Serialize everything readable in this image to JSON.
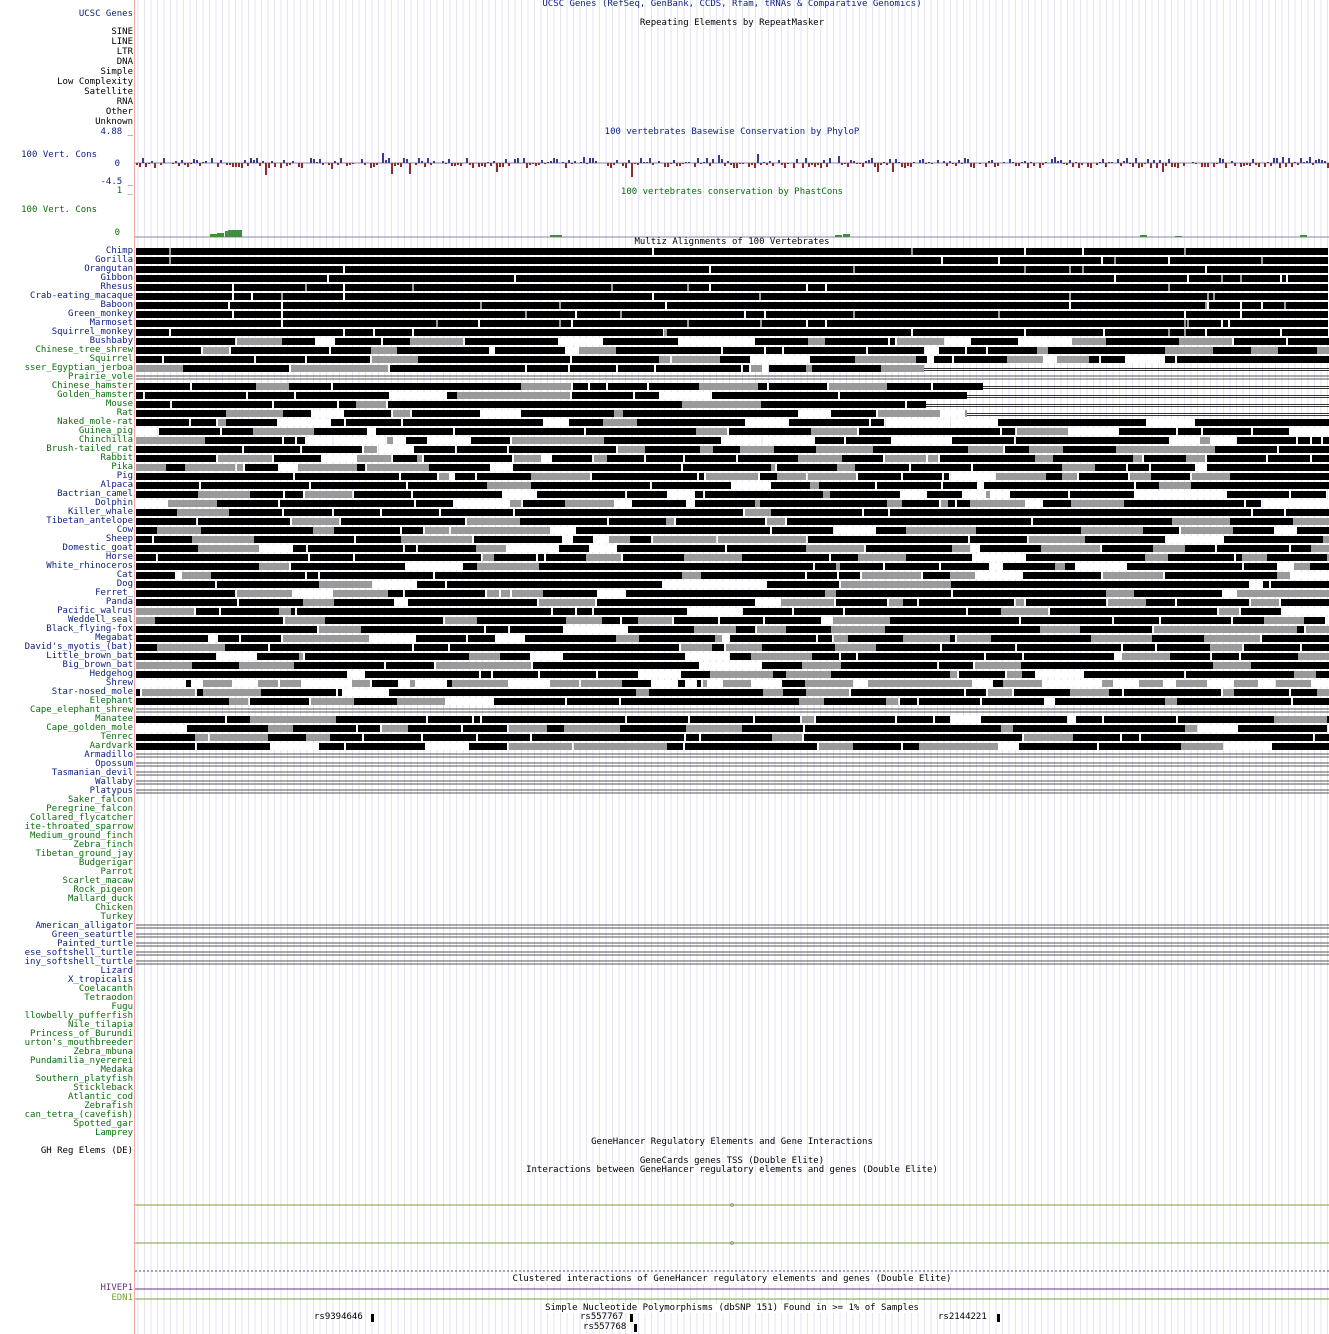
{
  "colors": {
    "navy": "#0b1e80",
    "green": "#0b6e0b",
    "black": "#000000",
    "purple": "#6b2f80",
    "olive": "#7ca13a",
    "phylop_pos": "#3b3a8f",
    "phylop_neg": "#8c2c2c",
    "phastcons": "#3f8f3f",
    "gray": "#9a9a9a",
    "lightgray": "#d6d6d6"
  },
  "ucsc_genes": {
    "label": "UCSC Genes",
    "title": "UCSC Genes (RefSeq, GenBank, CCDS, Rfam, tRNAs & Comparative Genomics)"
  },
  "repeatmasker": {
    "title": "Repeating Elements by RepeatMasker",
    "classes": [
      "SINE",
      "LINE",
      "LTR",
      "DNA",
      "Simple",
      "Low Complexity",
      "Satellite",
      "RNA",
      "Other",
      "Unknown"
    ]
  },
  "phylop": {
    "label": "100 Vert. Cons",
    "title": "100 vertebrates Basewise Conservation by PhyloP",
    "max_label": "4.88 _",
    "zero_label": "0",
    "min_label": "-4.5 _",
    "ymax": 4.88,
    "ymin": -4.5
  },
  "phastcons": {
    "label": "100 Vert. Cons",
    "title": "100 vertebrates conservation by PhastCons",
    "max_label": "1 _",
    "zero_label": "0"
  },
  "multiz": {
    "title": "Multiz Alignments of 100 Vertebrates",
    "species": [
      {
        "name": "Chimp",
        "group": "primate",
        "pattern": "dense"
      },
      {
        "name": "Gorilla",
        "group": "primate",
        "pattern": "dense"
      },
      {
        "name": "Orangutan",
        "group": "primate",
        "pattern": "dense"
      },
      {
        "name": "Gibbon",
        "group": "primate",
        "pattern": "dense"
      },
      {
        "name": "Rhesus",
        "group": "primate",
        "pattern": "dense"
      },
      {
        "name": "Crab-eating_macaque",
        "group": "primate",
        "pattern": "dense"
      },
      {
        "name": "Baboon",
        "group": "primate",
        "pattern": "dense"
      },
      {
        "name": "Green_monkey",
        "group": "primate",
        "pattern": "dense"
      },
      {
        "name": "Marmoset",
        "group": "primate",
        "pattern": "dense"
      },
      {
        "name": "Squirrel_monkey",
        "group": "primate",
        "pattern": "dense"
      },
      {
        "name": "Bushbaby",
        "group": "primate",
        "pattern": "mixed"
      },
      {
        "name": "Chinese_tree_shrew",
        "group": "euarchontoglires",
        "pattern": "mixed"
      },
      {
        "name": "Squirrel",
        "group": "euarchontoglires",
        "pattern": "mixed"
      },
      {
        "name": "sser_Egyptian_jerboa",
        "group": "euarchontoglires",
        "pattern": "partial"
      },
      {
        "name": "Prairie_vole",
        "group": "euarchontoglires",
        "pattern": "line"
      },
      {
        "name": "Chinese_hamster",
        "group": "euarchontoglires",
        "pattern": "partial"
      },
      {
        "name": "Golden_hamster",
        "group": "euarchontoglires",
        "pattern": "partial"
      },
      {
        "name": "Mouse",
        "group": "euarchontoglires",
        "pattern": "partial"
      },
      {
        "name": "Rat",
        "group": "euarchontoglires",
        "pattern": "partial"
      },
      {
        "name": "Naked_mole-rat",
        "group": "euarchontoglires",
        "pattern": "mixed"
      },
      {
        "name": "Guinea_pig",
        "group": "euarchontoglires",
        "pattern": "mixed"
      },
      {
        "name": "Chinchilla",
        "group": "euarchontoglires",
        "pattern": "mixed"
      },
      {
        "name": "Brush-tailed_rat",
        "group": "euarchontoglires",
        "pattern": "mixed"
      },
      {
        "name": "Rabbit",
        "group": "euarchontoglires",
        "pattern": "mixed"
      },
      {
        "name": "Pika",
        "group": "euarchontoglires",
        "pattern": "mixed"
      },
      {
        "name": "Pig",
        "group": "laurasiatheria",
        "pattern": "mixed"
      },
      {
        "name": "Alpaca",
        "group": "laurasiatheria",
        "pattern": "mixed"
      },
      {
        "name": "Bactrian_camel",
        "group": "laurasiatheria",
        "pattern": "mixed"
      },
      {
        "name": "Dolphin",
        "group": "laurasiatheria",
        "pattern": "mixed"
      },
      {
        "name": "Killer_whale",
        "group": "laurasiatheria",
        "pattern": "mixed"
      },
      {
        "name": "Tibetan_antelope",
        "group": "laurasiatheria",
        "pattern": "mixed"
      },
      {
        "name": "Cow",
        "group": "laurasiatheria",
        "pattern": "mixed"
      },
      {
        "name": "Sheep",
        "group": "laurasiatheria",
        "pattern": "mixed"
      },
      {
        "name": "Domestic_goat",
        "group": "laurasiatheria",
        "pattern": "mixed"
      },
      {
        "name": "Horse",
        "group": "laurasiatheria",
        "pattern": "mixed"
      },
      {
        "name": "White_rhinoceros",
        "group": "laurasiatheria",
        "pattern": "mixed"
      },
      {
        "name": "Cat",
        "group": "laurasiatheria",
        "pattern": "mixed"
      },
      {
        "name": "Dog",
        "group": "laurasiatheria",
        "pattern": "mixed"
      },
      {
        "name": "Ferret_",
        "group": "laurasiatheria",
        "pattern": "mixed"
      },
      {
        "name": "Panda",
        "group": "laurasiatheria",
        "pattern": "mixed"
      },
      {
        "name": "Pacific_walrus",
        "group": "laurasiatheria",
        "pattern": "mixed"
      },
      {
        "name": "Weddell_seal",
        "group": "laurasiatheria",
        "pattern": "mixed"
      },
      {
        "name": "Black_flying-fox",
        "group": "laurasiatheria",
        "pattern": "mixed"
      },
      {
        "name": "Megabat",
        "group": "laurasiatheria",
        "pattern": "mixed"
      },
      {
        "name": "David's_myotis_(bat)",
        "group": "laurasiatheria",
        "pattern": "mixed"
      },
      {
        "name": "Little_brown_bat",
        "group": "laurasiatheria",
        "pattern": "mixed"
      },
      {
        "name": "Big_brown_bat",
        "group": "laurasiatheria",
        "pattern": "mixed"
      },
      {
        "name": "Hedgehog",
        "group": "laurasiatheria",
        "pattern": "mixed"
      },
      {
        "name": "Shrew",
        "group": "laurasiatheria",
        "pattern": "sparse"
      },
      {
        "name": "Star-nosed_mole",
        "group": "laurasiatheria",
        "pattern": "mixed"
      },
      {
        "name": "Elephant",
        "group": "afrotheria",
        "pattern": "mixed"
      },
      {
        "name": "Cape_elephant_shrew",
        "group": "afrotheria",
        "pattern": "line"
      },
      {
        "name": "Manatee",
        "group": "afrotheria",
        "pattern": "mixed"
      },
      {
        "name": "Cape_golden_mole",
        "group": "afrotheria",
        "pattern": "mixed"
      },
      {
        "name": "Tenrec",
        "group": "afrotheria",
        "pattern": "mixed"
      },
      {
        "name": "Aardvark",
        "group": "afrotheria",
        "pattern": "mixed"
      },
      {
        "name": "Armadillo",
        "group": "xenarthra",
        "pattern": "line"
      },
      {
        "name": "Opossum",
        "group": "mammal",
        "pattern": "line"
      },
      {
        "name": "Tasmanian_devil",
        "group": "mammal",
        "pattern": "line"
      },
      {
        "name": "Wallaby",
        "group": "mammal",
        "pattern": "line"
      },
      {
        "name": "Platypus",
        "group": "mammal",
        "pattern": "line"
      },
      {
        "name": "Saker_falcon",
        "group": "bird",
        "pattern": "none"
      },
      {
        "name": "Peregrine_falcon",
        "group": "bird",
        "pattern": "none"
      },
      {
        "name": "Collared_flycatcher",
        "group": "bird",
        "pattern": "none"
      },
      {
        "name": "ite-throated_sparrow",
        "group": "bird",
        "pattern": "none"
      },
      {
        "name": "Medium_ground_finch",
        "group": "bird",
        "pattern": "none"
      },
      {
        "name": "Zebra_finch",
        "group": "bird",
        "pattern": "none"
      },
      {
        "name": "Tibetan_ground_jay",
        "group": "bird",
        "pattern": "none"
      },
      {
        "name": "Budgerigar",
        "group": "bird",
        "pattern": "none"
      },
      {
        "name": "Parrot",
        "group": "bird",
        "pattern": "none"
      },
      {
        "name": "Scarlet_macaw",
        "group": "bird",
        "pattern": "none"
      },
      {
        "name": "Rock_pigeon",
        "group": "bird",
        "pattern": "none"
      },
      {
        "name": "Mallard_duck",
        "group": "bird",
        "pattern": "none"
      },
      {
        "name": "Chicken",
        "group": "bird",
        "pattern": "none"
      },
      {
        "name": "Turkey",
        "group": "bird",
        "pattern": "none"
      },
      {
        "name": "American_alligator",
        "group": "sarcopsid",
        "pattern": "line"
      },
      {
        "name": "Green_seaturtle",
        "group": "sarcopsid",
        "pattern": "line"
      },
      {
        "name": "Painted_turtle",
        "group": "sarcopsid",
        "pattern": "line"
      },
      {
        "name": "ese_softshell_turtle",
        "group": "sarcopsid",
        "pattern": "line"
      },
      {
        "name": "iny_softshell_turtle",
        "group": "sarcopsid",
        "pattern": "line"
      },
      {
        "name": "Lizard",
        "group": "sarcopsid",
        "pattern": "none"
      },
      {
        "name": "X_tropicalis",
        "group": "sarcopsid",
        "pattern": "none"
      },
      {
        "name": "Coelacanth",
        "group": "fish",
        "pattern": "none"
      },
      {
        "name": "Tetraodon",
        "group": "fish",
        "pattern": "none"
      },
      {
        "name": "Fugu",
        "group": "fish",
        "pattern": "none"
      },
      {
        "name": "llowbelly_pufferfish",
        "group": "fish",
        "pattern": "none"
      },
      {
        "name": "Nile_tilapia",
        "group": "fish",
        "pattern": "none"
      },
      {
        "name": "Princess_of_Burundi",
        "group": "fish",
        "pattern": "none"
      },
      {
        "name": "urton's_mouthbreeder",
        "group": "fish",
        "pattern": "none"
      },
      {
        "name": "Zebra_mbuna",
        "group": "fish",
        "pattern": "none"
      },
      {
        "name": "Pundamilia_nyererei",
        "group": "fish",
        "pattern": "none"
      },
      {
        "name": "Medaka",
        "group": "fish",
        "pattern": "none"
      },
      {
        "name": "Southern_platyfish",
        "group": "fish",
        "pattern": "none"
      },
      {
        "name": "Stickleback",
        "group": "fish",
        "pattern": "none"
      },
      {
        "name": "Atlantic_cod",
        "group": "fish",
        "pattern": "none"
      },
      {
        "name": "Zebrafish",
        "group": "fish",
        "pattern": "none"
      },
      {
        "name": "can_tetra_(cavefish)",
        "group": "fish",
        "pattern": "none"
      },
      {
        "name": "Spotted_gar",
        "group": "fish",
        "pattern": "none"
      },
      {
        "name": "Lamprey",
        "group": "fish",
        "pattern": "none"
      }
    ]
  },
  "genehancer": {
    "title": "GeneHancer Regulatory Elements and Gene Interactions",
    "label": "GH Reg Elems (DE)",
    "tss_title": "GeneCards genes TSS (Double Elite)",
    "interactions_title": "Interactions between GeneHancer regulatory elements and genes (Double Elite)",
    "clustered_title": "Clustered interactions of GeneHancer regulatory elements and genes (Double Elite)",
    "genes": [
      "HIVEP1",
      "EDN1"
    ]
  },
  "snp": {
    "title": "Simple Nucleotide Polymorphisms (dbSNP 151) Found in >= 1% of Samples",
    "variants": [
      {
        "id": "rs9394646"
      },
      {
        "id": "rs557767"
      },
      {
        "id": "rs557768"
      },
      {
        "id": "rs2144221"
      }
    ]
  }
}
